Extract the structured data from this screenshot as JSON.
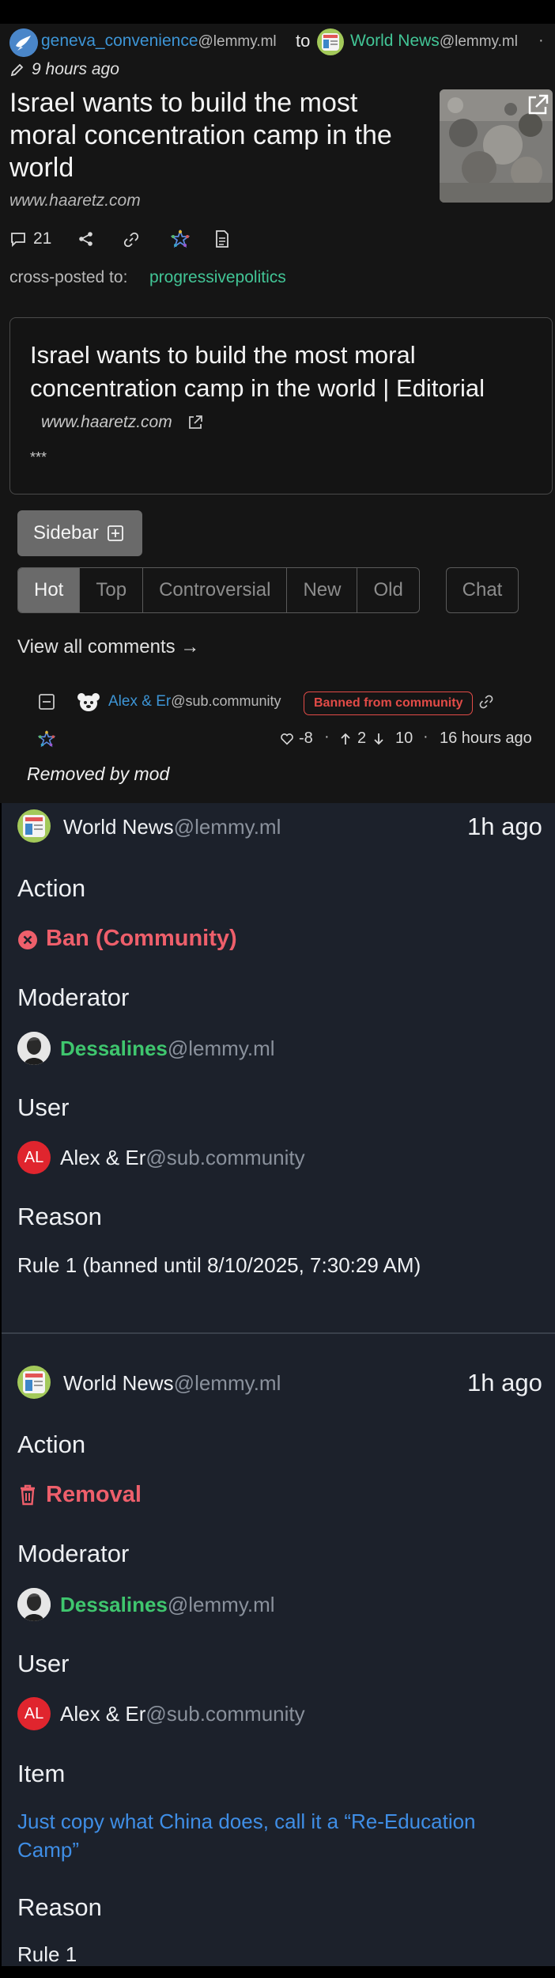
{
  "post": {
    "author_name": "geneva_convenience",
    "author_instance": "@lemmy.ml",
    "to_word": "to",
    "community_name": "World News",
    "community_instance": "@lemmy.ml",
    "separator": "·",
    "time": "9 hours ago",
    "title": "Israel wants to build the most moral concentration camp in the world",
    "domain": "www.haaretz.com",
    "comment_count": "21",
    "crosspost_label": "cross-posted to:",
    "crosspost_community": "progressivepolitics"
  },
  "embed": {
    "title": "Israel wants to build the most moral concentration camp in the world | Editorial",
    "domain": "www.haaretz.com",
    "body": "***"
  },
  "controls": {
    "sidebar_label": "Sidebar",
    "sort_options": [
      "Hot",
      "Top",
      "Controversial",
      "New",
      "Old"
    ],
    "active_sort": "Hot",
    "chat_label": "Chat",
    "view_all_label": "View all comments →"
  },
  "comment": {
    "author_name": "Alex & Er",
    "author_instance": "@sub.community",
    "badge": "Banned from community",
    "score": "-8",
    "upvotes": "2",
    "downvotes": "10",
    "time": "16 hours ago",
    "body": "Removed by mod"
  },
  "modlog": [
    {
      "community_name": "World News",
      "community_instance": "@lemmy.ml",
      "time": "1h ago",
      "action_heading": "Action",
      "action": "Ban (Community)",
      "action_icon": "x-circle-icon",
      "moderator_heading": "Moderator",
      "moderator_name": "Dessalines",
      "moderator_instance": "@lemmy.ml",
      "user_heading": "User",
      "user_avatar_text": "AL",
      "user_name": "Alex & Er",
      "user_instance": "@sub.community",
      "reason_heading": "Reason",
      "reason": "Rule 1 (banned until 8/10/2025, 7:30:29 AM)"
    },
    {
      "community_name": "World News",
      "community_instance": "@lemmy.ml",
      "time": "1h ago",
      "action_heading": "Action",
      "action": "Removal",
      "action_icon": "trash-icon",
      "moderator_heading": "Moderator",
      "moderator_name": "Dessalines",
      "moderator_instance": "@lemmy.ml",
      "user_heading": "User",
      "user_avatar_text": "AL",
      "user_name": "Alex & Er",
      "user_instance": "@sub.community",
      "item_heading": "Item",
      "item": "Just copy what China does, call it a “Re-Education Camp”",
      "reason_heading": "Reason",
      "reason": "Rule 1"
    }
  ],
  "colors": {
    "accent_blue": "#3d95d6",
    "accent_teal": "#42c596",
    "banned_red": "#e24b47",
    "modlog_bg": "#1c212b",
    "action_red": "#ee5f6b",
    "moderator_green": "#3fc66e",
    "link_blue": "#3f8ee6"
  }
}
